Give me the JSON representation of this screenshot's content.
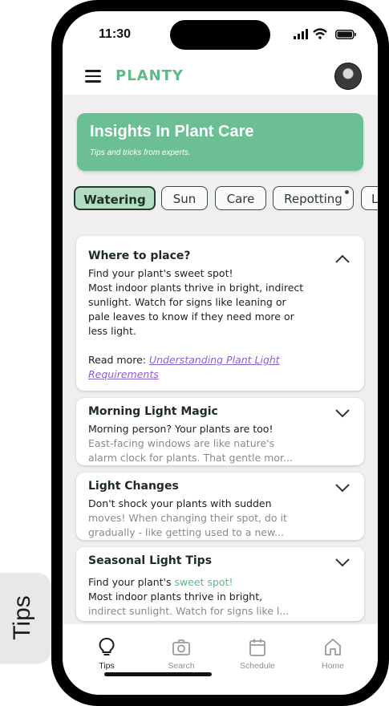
{
  "side_tab": {
    "label": "Tips"
  },
  "status_bar": {
    "time": "11:30"
  },
  "app_bar": {
    "brand": "PLANTY"
  },
  "banner": {
    "title": "Insights In Plant Care",
    "subtitle": "Tips and tricks from experts."
  },
  "chips": [
    {
      "label": "Watering",
      "selected": true
    },
    {
      "label": "Sun",
      "selected": false
    },
    {
      "label": "Care",
      "selected": false
    },
    {
      "label": "Repotting",
      "selected": false,
      "has_dot": true
    },
    {
      "label": "L",
      "selected": false
    }
  ],
  "cards": [
    {
      "title": "Where to place?",
      "expanded": true,
      "line1": "Find your plant's sweet spot!",
      "line2": "Most indoor plants thrive in bright, indirect",
      "line3": "sunlight. Watch for signs like leaning or",
      "line4": "pale leaves to know if they need more or",
      "line5": "less light.",
      "read_more": "Read more:",
      "link_line1": "Understanding Plant Light",
      "link_line2": "Requirements"
    },
    {
      "title": "Morning Light Magic",
      "expanded": false,
      "line1": "Morning person? Your plants are too!",
      "line2": "East-facing windows are like nature's",
      "line3": "alarm clock for plants. That gentle mor..."
    },
    {
      "title": "Light Changes",
      "expanded": false,
      "line1": "Don't shock your plants with sudden",
      "line2": "moves! When changing their spot, do it",
      "line3": "gradually - like getting used to a new..."
    },
    {
      "title": "Seasonal Light Tips",
      "expanded": false,
      "line1a": "Find your plant's ",
      "line1b": "sweet spot!",
      "line2": "Most indoor plants thrive in bright,",
      "line3": "indirect sunlight. Watch for signs like l..."
    }
  ],
  "nav": [
    {
      "label": "Tips",
      "icon": "lightbulb-icon",
      "active": true
    },
    {
      "label": "Search",
      "icon": "camera-icon",
      "active": false
    },
    {
      "label": "Schedule",
      "icon": "calendar-icon",
      "active": false
    },
    {
      "label": "Home",
      "icon": "home-icon",
      "active": false
    }
  ],
  "colors": {
    "accent": "#6bbf93",
    "brand": "#5cb98a",
    "chip_selected": "#b2dcc4",
    "link": "#8a5fd0"
  }
}
